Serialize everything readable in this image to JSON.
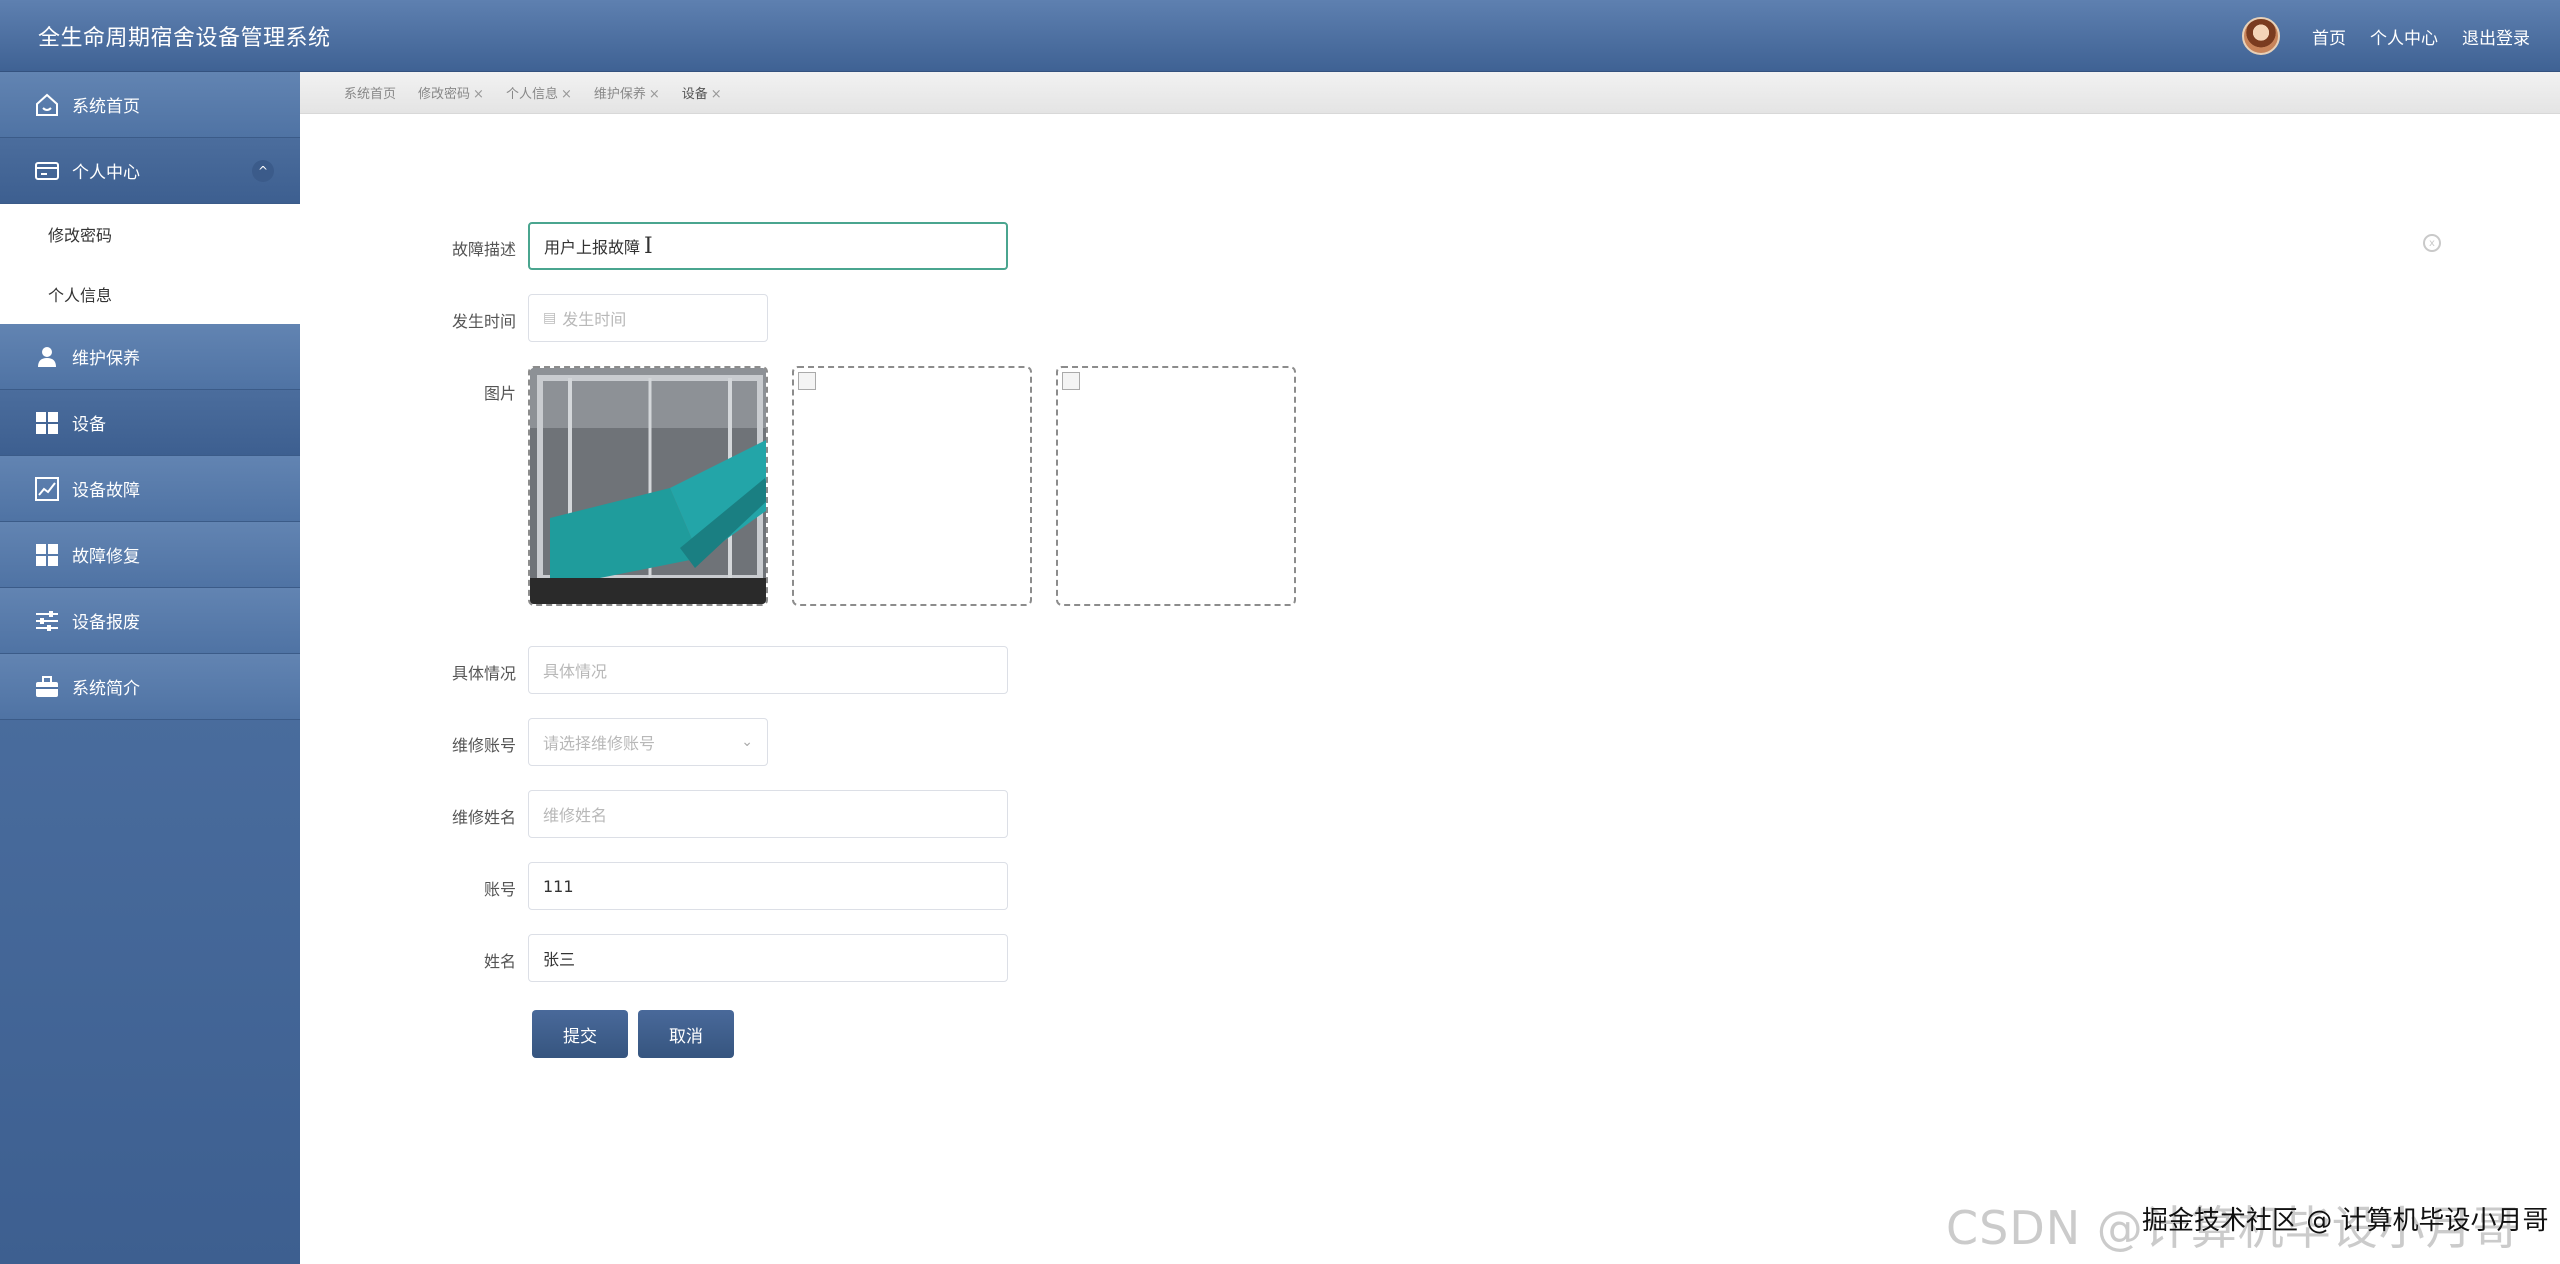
{
  "app": {
    "title": "全生命周期宿舍设备管理系统"
  },
  "header": {
    "links": {
      "home": "首页",
      "profile": "个人中心",
      "logout": "退出登录"
    }
  },
  "sidebar": {
    "items": [
      {
        "label": "系统首页",
        "icon": "home-icon"
      },
      {
        "label": "个人中心",
        "icon": "card-icon"
      },
      {
        "label": "维护保养",
        "icon": "user-icon"
      },
      {
        "label": "设备",
        "icon": "grid-icon"
      },
      {
        "label": "设备故障",
        "icon": "chart-icon"
      },
      {
        "label": "故障修复",
        "icon": "grid-icon"
      },
      {
        "label": "设备报废",
        "icon": "sliders-icon"
      },
      {
        "label": "系统简介",
        "icon": "briefcase-icon"
      }
    ],
    "submenu": [
      {
        "label": "修改密码"
      },
      {
        "label": "个人信息"
      }
    ]
  },
  "tabs": [
    {
      "label": "系统首页",
      "closable": false
    },
    {
      "label": "修改密码",
      "closable": true
    },
    {
      "label": "个人信息",
      "closable": true
    },
    {
      "label": "维护保养",
      "closable": true
    },
    {
      "label": "设备",
      "closable": true,
      "active": true
    }
  ],
  "tab_close": "×",
  "form": {
    "fault_desc": {
      "label": "故障描述",
      "value": "用户上报故障"
    },
    "occur_time": {
      "label": "发生时间",
      "placeholder": "发生时间"
    },
    "pictures": {
      "label": "图片",
      "count": 3
    },
    "details": {
      "label": "具体情况",
      "placeholder": "具体情况"
    },
    "repair_account": {
      "label": "维修账号",
      "placeholder": "请选择维修账号"
    },
    "repair_name": {
      "label": "维修姓名",
      "placeholder": "维修姓名"
    },
    "account": {
      "label": "账号",
      "value": "111"
    },
    "name": {
      "label": "姓名",
      "value": "张三"
    }
  },
  "buttons": {
    "submit": "提交",
    "cancel": "取消"
  },
  "watermark": {
    "text1": "CSDN @计算机毕设小月哥",
    "text2": "掘金技术社区 @ 计算机毕设小月哥"
  },
  "colors": {
    "primary": "#3d5f90",
    "focus": "#4aa58f"
  }
}
